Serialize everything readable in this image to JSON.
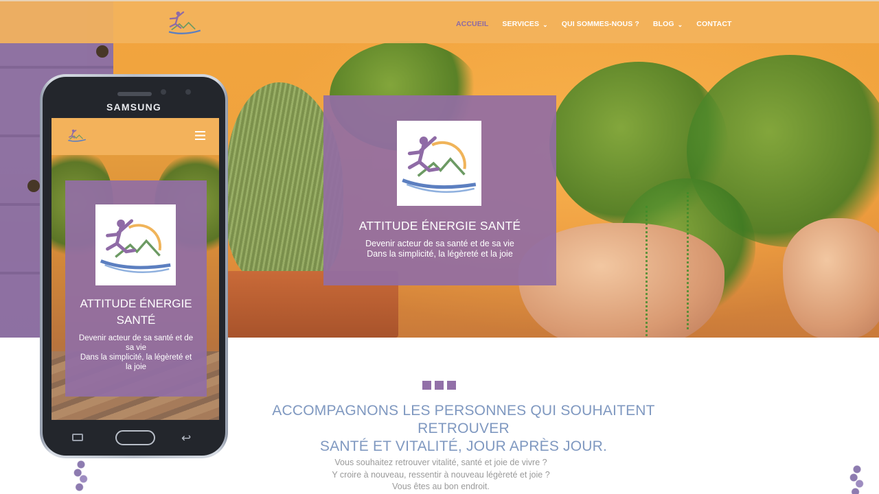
{
  "colors": {
    "header_bg": "#f3b35d",
    "purple": "#926ea3",
    "nav_active": "#8c6aa3",
    "mission_text": "#7f98c0",
    "body_text": "#9a9a9a"
  },
  "nav": {
    "items": [
      {
        "label": "ACCUEIL",
        "active": true,
        "has_dropdown": false
      },
      {
        "label": "SERVICES",
        "active": false,
        "has_dropdown": true
      },
      {
        "label": "QUI SOMMES-NOUS ?",
        "active": false,
        "has_dropdown": false
      },
      {
        "label": "BLOG",
        "active": false,
        "has_dropdown": true
      },
      {
        "label": "CONTACT",
        "active": false,
        "has_dropdown": false
      }
    ],
    "dropdown_icon": "chevron-down-icon"
  },
  "hero": {
    "title": "ATTITUDE ÉNERGIE SANTÉ",
    "subtitle_line1": "Devenir acteur de sa santé et de sa vie",
    "subtitle_line2": "Dans la simplicité, la légèreté et la joie"
  },
  "mission": {
    "line1": "ACCOMPAGNONS LES PERSONNES QUI SOUHAITENT RETROUVER",
    "line2": "SANTÉ ET VITALITÉ, JOUR APRÈS JOUR."
  },
  "intro": {
    "line1": "Vous souhaitez retrouver vitalité, santé et joie de vivre ?",
    "line2": "Y croire à nouveau, ressentir à nouveau légèreté et joie ?",
    "line3": "Vous êtes au bon endroit."
  },
  "phone": {
    "brand": "SAMSUNG",
    "menu_icon": "hamburger-menu-icon",
    "title_line1": "ATTITUDE ÉNERGIE",
    "title_line2": "SANTÉ",
    "subtitle_line1": "Devenir acteur de sa santé et de",
    "subtitle_line2": "sa vie",
    "subtitle_line3": "Dans la simplicité, la légèreté et",
    "subtitle_line4": "la joie"
  }
}
